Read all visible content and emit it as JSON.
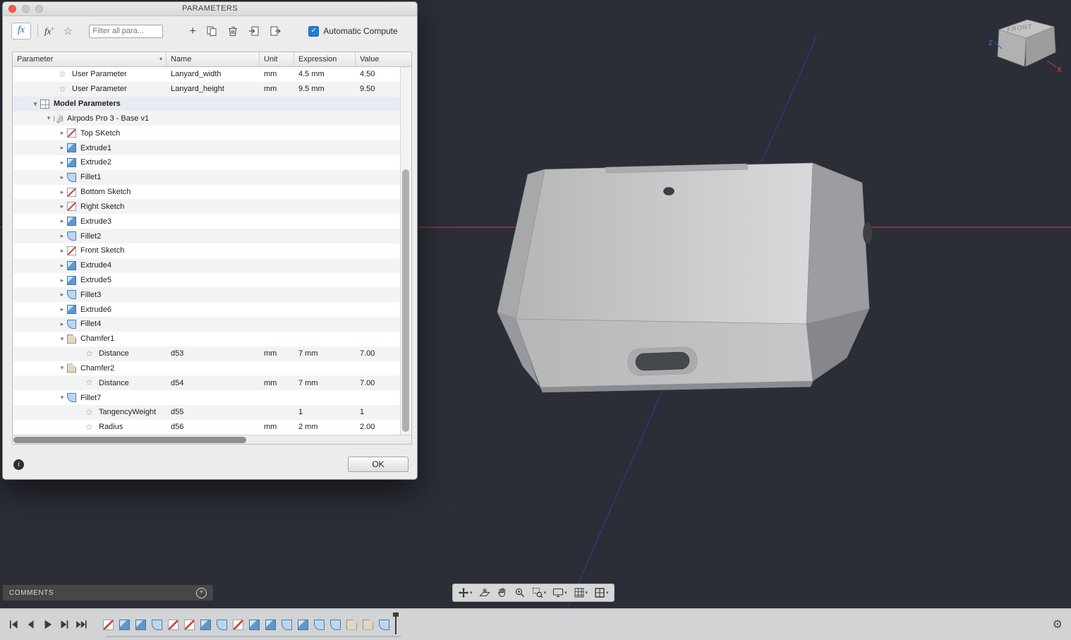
{
  "window": {
    "title": "PARAMETERS"
  },
  "toolbar": {
    "fx_label": "fx",
    "filter_placeholder": "Filter all para...",
    "auto_compute_label": "Automatic Compute",
    "auto_compute_checked": true
  },
  "table": {
    "columns": [
      "Parameter",
      "Name",
      "Unit",
      "Expression",
      "Value"
    ],
    "rows": [
      {
        "indent": 3,
        "icon": "star",
        "chevron": "none",
        "label": "User Parameter",
        "name": "Lanyard_width",
        "unit": "mm",
        "expression": "4.5 mm",
        "value": "4.50"
      },
      {
        "indent": 3,
        "icon": "star",
        "chevron": "none",
        "label": "User Parameter",
        "name": "Lanyard_height",
        "unit": "mm",
        "expression": "9.5 mm",
        "value": "9.50"
      },
      {
        "indent": 1,
        "icon": "model",
        "chevron": "down",
        "label": "Model Parameters",
        "bold": true,
        "name": "",
        "unit": "",
        "expression": "",
        "value": ""
      },
      {
        "indent": 2,
        "icon": "component",
        "chevron": "down",
        "label": "Airpods Pro 3 - Base v1",
        "name": "",
        "unit": "",
        "expression": "",
        "value": ""
      },
      {
        "indent": 3,
        "icon": "sketch",
        "chevron": "right",
        "label": "Top SKetch",
        "name": "",
        "unit": "",
        "expression": "",
        "value": ""
      },
      {
        "indent": 3,
        "icon": "extrude",
        "chevron": "right",
        "label": "Extrude1",
        "name": "",
        "unit": "",
        "expression": "",
        "value": ""
      },
      {
        "indent": 3,
        "icon": "extrude",
        "chevron": "right",
        "label": "Extrude2",
        "name": "",
        "unit": "",
        "expression": "",
        "value": ""
      },
      {
        "indent": 3,
        "icon": "fillet",
        "chevron": "right",
        "label": "Fillet1",
        "name": "",
        "unit": "",
        "expression": "",
        "value": ""
      },
      {
        "indent": 3,
        "icon": "sketch",
        "chevron": "right",
        "label": "Bottom Sketch",
        "name": "",
        "unit": "",
        "expression": "",
        "value": ""
      },
      {
        "indent": 3,
        "icon": "sketch",
        "chevron": "right",
        "label": "Right Sketch",
        "name": "",
        "unit": "",
        "expression": "",
        "value": ""
      },
      {
        "indent": 3,
        "icon": "extrude",
        "chevron": "right",
        "label": "Extrude3",
        "name": "",
        "unit": "",
        "expression": "",
        "value": ""
      },
      {
        "indent": 3,
        "icon": "fillet",
        "chevron": "right",
        "label": "Fillet2",
        "name": "",
        "unit": "",
        "expression": "",
        "value": ""
      },
      {
        "indent": 3,
        "icon": "sketch",
        "chevron": "right",
        "label": "Front Sketch",
        "name": "",
        "unit": "",
        "expression": "",
        "value": ""
      },
      {
        "indent": 3,
        "icon": "extrude",
        "chevron": "right",
        "label": "Extrude4",
        "name": "",
        "unit": "",
        "expression": "",
        "value": ""
      },
      {
        "indent": 3,
        "icon": "extrude",
        "chevron": "right",
        "label": "Extrude5",
        "name": "",
        "unit": "",
        "expression": "",
        "value": ""
      },
      {
        "indent": 3,
        "icon": "fillet",
        "chevron": "right",
        "label": "Fillet3",
        "name": "",
        "unit": "",
        "expression": "",
        "value": ""
      },
      {
        "indent": 3,
        "icon": "extrude",
        "chevron": "right",
        "label": "Extrude6",
        "name": "",
        "unit": "",
        "expression": "",
        "value": ""
      },
      {
        "indent": 3,
        "icon": "fillet",
        "chevron": "right",
        "label": "Fillet4",
        "name": "",
        "unit": "",
        "expression": "",
        "value": ""
      },
      {
        "indent": 3,
        "icon": "chamfer",
        "chevron": "down",
        "label": "Chamfer1",
        "name": "",
        "unit": "",
        "expression": "",
        "value": ""
      },
      {
        "indent": 5,
        "icon": "star",
        "chevron": "none",
        "label": "Distance",
        "name": "d53",
        "unit": "mm",
        "expression": "7 mm",
        "value": "7.00"
      },
      {
        "indent": 3,
        "icon": "chamfer",
        "chevron": "down",
        "label": "Chamfer2",
        "name": "",
        "unit": "",
        "expression": "",
        "value": ""
      },
      {
        "indent": 5,
        "icon": "star",
        "chevron": "none",
        "label": "Distance",
        "name": "d54",
        "unit": "mm",
        "expression": "7 mm",
        "value": "7.00"
      },
      {
        "indent": 3,
        "icon": "fillet",
        "chevron": "down",
        "label": "Fillet7",
        "name": "",
        "unit": "",
        "expression": "",
        "value": ""
      },
      {
        "indent": 5,
        "icon": "star",
        "chevron": "none",
        "label": "TangencyWeight",
        "name": "d55",
        "unit": "",
        "expression": "1",
        "value": "1"
      },
      {
        "indent": 5,
        "icon": "star",
        "chevron": "none",
        "label": "Radius",
        "name": "d56",
        "unit": "mm",
        "expression": "2 mm",
        "value": "2.00"
      }
    ]
  },
  "dialog": {
    "ok_label": "OK"
  },
  "viewport": {
    "viewcube": {
      "front_label": "FRONT",
      "z_label": "Z",
      "x_label": "X"
    },
    "navbar_items": [
      {
        "name": "pan-icon",
        "caret": true
      },
      {
        "name": "look-at-icon",
        "caret": false
      },
      {
        "name": "orbit-hand-icon",
        "caret": false
      },
      {
        "name": "zoom-icon",
        "caret": false
      },
      {
        "name": "zoom-window-icon",
        "caret": true
      },
      {
        "name": "display-settings-icon",
        "caret": true
      },
      {
        "name": "grid-settings-icon",
        "caret": true
      },
      {
        "name": "viewports-icon",
        "caret": true
      }
    ],
    "colors": {
      "background": "#2b2e37",
      "x_axis": "#a83a3a",
      "z_axis": "#2b3d8f",
      "model_light": "#d6d7d8",
      "model_dark": "#8f9194"
    }
  },
  "comments": {
    "label": "COMMENTS"
  },
  "timeline": {
    "features": [
      "sketch",
      "extrude",
      "extrude",
      "fillet",
      "sketch",
      "sketch",
      "extrude",
      "fillet",
      "sketch",
      "extrude",
      "extrude",
      "fillet",
      "extrude",
      "fillet",
      "fillet",
      "chamfer",
      "chamfer",
      "fillet"
    ]
  },
  "icons": {
    "star": "☆",
    "chevron_down": "▾",
    "chevron_right": "▸",
    "header_caret": "▾",
    "nav_caret": "▾",
    "gear": "⚙",
    "info": "i",
    "plus": "+",
    "check": "✓",
    "comments_plus": "+"
  }
}
